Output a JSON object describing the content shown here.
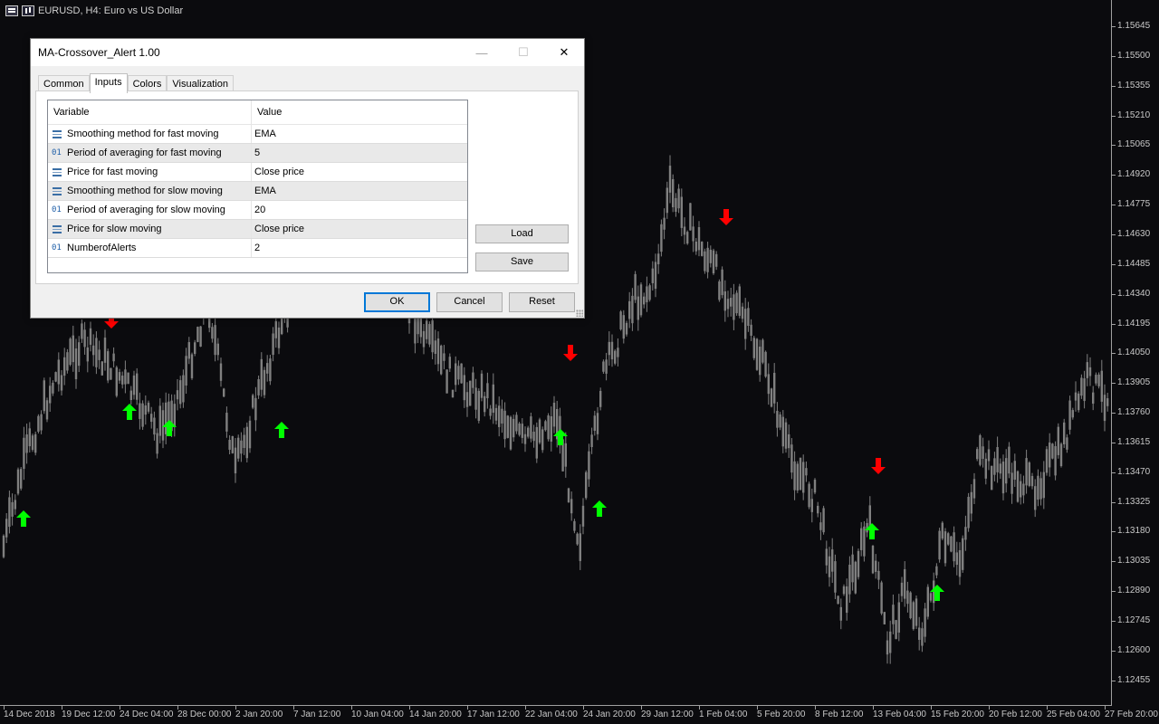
{
  "chart": {
    "title": "EURUSD, H4:  Euro vs US Dollar",
    "price_axis": [
      "1.15645",
      "1.15500",
      "1.15355",
      "1.15210",
      "1.15065",
      "1.14920",
      "1.14775",
      "1.14630",
      "1.14485",
      "1.14340",
      "1.14195",
      "1.14050",
      "1.13905",
      "1.13760",
      "1.13615",
      "1.13470",
      "1.13325",
      "1.13180",
      "1.13035",
      "1.12890",
      "1.12745",
      "1.12600",
      "1.12455"
    ],
    "time_axis": [
      "14 Dec 2018",
      "19 Dec 12:00",
      "24 Dec 04:00",
      "28 Dec 00:00",
      "2 Jan 20:00",
      "7 Jan 12:00",
      "10 Jan 04:00",
      "14 Jan 20:00",
      "17 Jan 12:00",
      "22 Jan 04:00",
      "24 Jan 20:00",
      "29 Jan 12:00",
      "1 Feb 04:00",
      "5 Feb 20:00",
      "8 Feb 12:00",
      "13 Feb 04:00",
      "15 Feb 20:00",
      "20 Feb 12:00",
      "25 Feb 04:00",
      "27 Feb 20:00"
    ],
    "colors": {
      "background": "#0b0b0e",
      "candles": "#808080",
      "buy_arrow": "#00ff00",
      "sell_arrow": "#ff0000"
    }
  },
  "dialog": {
    "title": "MA-Crossover_Alert 1.00",
    "controls": {
      "minimize": "—",
      "maximize": "☐",
      "close": "✕"
    },
    "tabs": [
      {
        "label": "Common",
        "active": false
      },
      {
        "label": "Inputs",
        "active": true
      },
      {
        "label": "Colors",
        "active": false
      },
      {
        "label": "Visualization",
        "active": false
      }
    ],
    "grid": {
      "headers": {
        "variable": "Variable",
        "value": "Value"
      },
      "rows": [
        {
          "icon": "list-icon",
          "variable": "Smoothing method for fast moving",
          "value": "EMA"
        },
        {
          "icon": "number-icon",
          "icon_text": "01",
          "variable": "Period of averaging for fast moving",
          "value": "5"
        },
        {
          "icon": "list-icon",
          "variable": "Price for fast moving",
          "value": "Close price"
        },
        {
          "icon": "list-icon",
          "variable": "Smoothing method for slow moving",
          "value": "EMA"
        },
        {
          "icon": "number-icon",
          "icon_text": "01",
          "variable": "Period of averaging for slow moving",
          "value": "20"
        },
        {
          "icon": "list-icon",
          "variable": "Price for slow moving",
          "value": "Close price"
        },
        {
          "icon": "number-icon",
          "icon_text": "01",
          "variable": "NumberofAlerts",
          "value": "2"
        }
      ]
    },
    "buttons": {
      "load": "Load",
      "save": "Save",
      "ok": "OK",
      "cancel": "Cancel",
      "reset": "Reset"
    }
  }
}
